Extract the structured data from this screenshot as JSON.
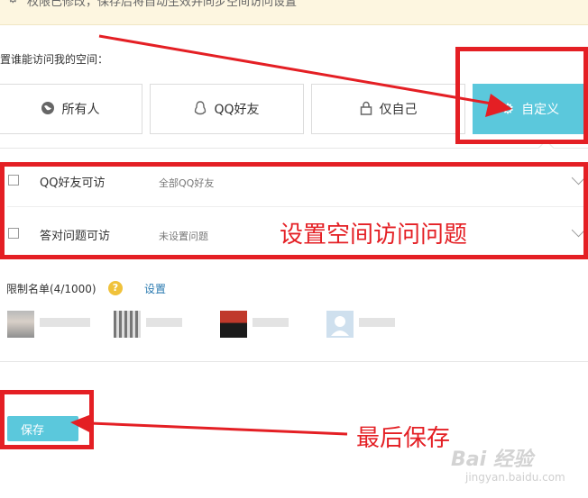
{
  "notice": {
    "text": "权限已修改，保存后将自动生效并同步空间访问设置",
    "icon": "gear-icon"
  },
  "access_section": {
    "label": "置谁能访问我的空间："
  },
  "options": [
    {
      "id": "all",
      "label": "所有人",
      "icon": "globe-icon",
      "selected": false
    },
    {
      "id": "friends",
      "label": "QQ好友",
      "icon": "qq-penguin-icon",
      "selected": false
    },
    {
      "id": "self",
      "label": "仅自己",
      "icon": "lock-icon",
      "selected": false
    },
    {
      "id": "custom",
      "label": "自定义",
      "icon": "gear-icon",
      "selected": true
    }
  ],
  "custom_rows": [
    {
      "title": "QQ好友可访",
      "desc": "全部QQ好友",
      "checked": false
    },
    {
      "title": "答对问题可访",
      "desc": "未设置问题",
      "checked": false
    }
  ],
  "restrict": {
    "label": "限制名单(4/1000)",
    "help": "?",
    "set_link": "设置"
  },
  "save_button": "保存",
  "annotations": {
    "question": "设置空间访问问题",
    "save": "最后保存"
  },
  "watermark": {
    "logo": "Bai 经验",
    "domain": "jingyan.baidu.com"
  },
  "colors": {
    "accent": "#5bc8dc",
    "annotation_red": "#e41f24",
    "notice_bg": "#fdf6e0",
    "help_badge": "#f0c23b",
    "link": "#2a7ab0"
  }
}
